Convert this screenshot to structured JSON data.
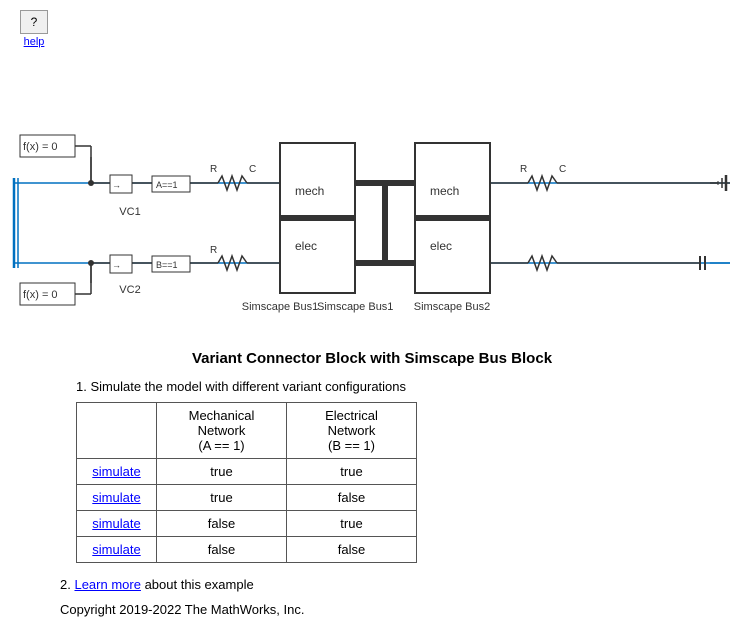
{
  "help": {
    "question_mark": "?",
    "link_label": "help"
  },
  "diagram": {
    "description": "Simscape bus diagram with two buses and variant connectors"
  },
  "content": {
    "title": "Variant Connector Block with Simscape Bus Block",
    "step1_label": "1.",
    "step1_text": "Simulate the model with different variant configurations",
    "table": {
      "col1_header": "",
      "col2_header": "Mechanical Network\n(A == 1)",
      "col3_header": "Electrical Network\n(B == 1)",
      "rows": [
        {
          "simulate": "simulate",
          "mech": "true",
          "elec": "true"
        },
        {
          "simulate": "simulate",
          "mech": "true",
          "elec": "false"
        },
        {
          "simulate": "simulate",
          "mech": "false",
          "elec": "true"
        },
        {
          "simulate": "simulate",
          "mech": "false",
          "elec": "false"
        }
      ]
    },
    "step2_label": "2.",
    "step2_learn_text": "Learn more",
    "step2_rest": " about this example",
    "copyright": "Copyright 2019-2022 The MathWorks, Inc."
  }
}
